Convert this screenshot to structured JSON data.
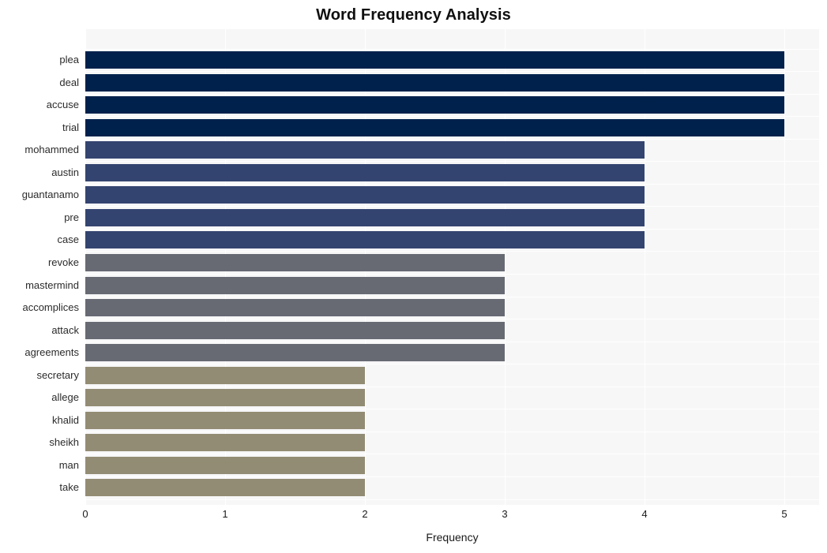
{
  "chart_data": {
    "type": "bar",
    "orientation": "horizontal",
    "title": "Word Frequency Analysis",
    "xlabel": "Frequency",
    "ylabel": "",
    "categories": [
      "plea",
      "deal",
      "accuse",
      "trial",
      "mohammed",
      "austin",
      "guantanamo",
      "pre",
      "case",
      "revoke",
      "mastermind",
      "accomplices",
      "attack",
      "agreements",
      "secretary",
      "allege",
      "khalid",
      "sheikh",
      "man",
      "take"
    ],
    "values": [
      5,
      5,
      5,
      5,
      4,
      4,
      4,
      4,
      4,
      3,
      3,
      3,
      3,
      3,
      2,
      2,
      2,
      2,
      2,
      2
    ],
    "bar_colors": [
      "#00214c",
      "#00214c",
      "#00214c",
      "#00214c",
      "#344470",
      "#344470",
      "#344470",
      "#344470",
      "#344470",
      "#676a73",
      "#676a73",
      "#676a73",
      "#676a73",
      "#676a73",
      "#938c74",
      "#938c74",
      "#938c74",
      "#938c74",
      "#938c74",
      "#938c74"
    ],
    "xlim": [
      0,
      5
    ],
    "xticks": [
      0,
      1,
      2,
      3,
      4,
      5
    ],
    "xtick_labels": [
      "0",
      "1",
      "2",
      "3",
      "4",
      "5"
    ],
    "grid": true,
    "grid_color": "#ffffff",
    "plot_background": "#f7f7f8",
    "figure_background": "#ffffff",
    "legend": null,
    "palette": {
      "tier_5": "#00214c",
      "tier_4": "#344470",
      "tier_3": "#676a73",
      "tier_2": "#938c74"
    }
  }
}
